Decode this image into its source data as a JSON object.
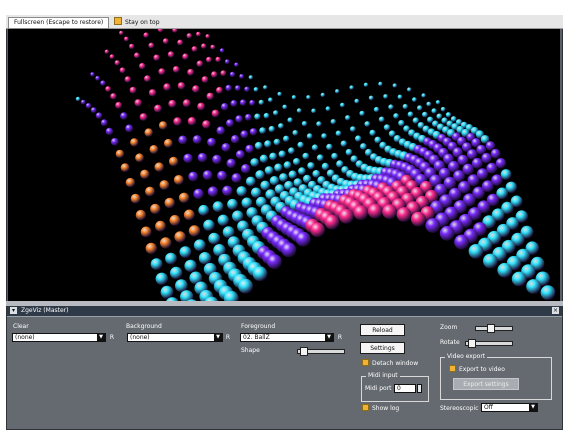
{
  "topbar": {
    "fullscreen_tab": "Fullscreen (Escape to restore)",
    "stay_on_top": "Stay on top"
  },
  "panel": {
    "title": "ZgeViz (Master)",
    "clear": {
      "label": "Clear",
      "value": "(none)",
      "reset": "R"
    },
    "background": {
      "label": "Background",
      "value": "(none)",
      "reset": "R"
    },
    "foreground": {
      "label": "Foreground",
      "value": "02. BallZ",
      "reset": "R"
    },
    "shape": {
      "label": "Shape",
      "level": 0.05
    },
    "reload": "Reload",
    "settings": "Settings",
    "detach": "Detach window",
    "midi": {
      "group": "Midi input",
      "port_label": "Midi port",
      "port_value": "0"
    },
    "show_log": "Show log",
    "zoom": {
      "label": "Zoom",
      "level": 0.35
    },
    "rotate": {
      "label": "Rotate",
      "level": 0.05
    },
    "video": {
      "group": "Video export",
      "export_label": "Export to video",
      "export_settings": "Export settings"
    },
    "stereoscopic": {
      "label": "Stereoscopic",
      "value": "Off"
    }
  },
  "colors": {
    "pink": "#ff2d8f",
    "purple": "#7a2cff",
    "cyan": "#33e6ff",
    "orange": "#ff8a2e",
    "background": "#000000"
  }
}
